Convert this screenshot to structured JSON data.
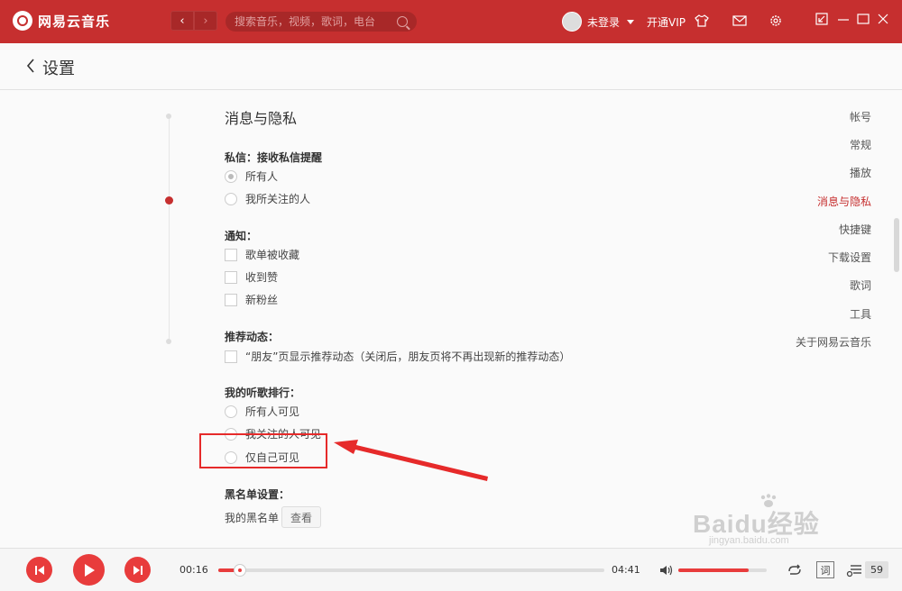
{
  "app": {
    "name": "网易云音乐",
    "brand_color": "#c62f2f"
  },
  "titlebar": {
    "nav_back_icon": "chevron-left",
    "nav_forward_icon": "chevron-right",
    "search_placeholder": "搜索音乐，视频，歌词，电台",
    "user_name": "未登录",
    "vip_label": "开通VIP"
  },
  "page": {
    "back_icon": "chevron-left",
    "title": "设置"
  },
  "sidebar": {
    "items": [
      {
        "label": "帐号"
      },
      {
        "label": "常规"
      },
      {
        "label": "播放"
      },
      {
        "label": "消息与隐私"
      },
      {
        "label": "快捷键"
      },
      {
        "label": "下载设置"
      },
      {
        "label": "歌词"
      },
      {
        "label": "工具"
      },
      {
        "label": "关于网易云音乐"
      }
    ],
    "active": "消息与隐私"
  },
  "content": {
    "section_title": "消息与隐私",
    "private_msg": {
      "title": "私信：接收私信提醒",
      "options": [
        "所有人",
        "我所关注的人"
      ],
      "selected": "所有人"
    },
    "notify": {
      "title": "通知：",
      "options": [
        "歌单被收藏",
        "收到赞",
        "新粉丝"
      ]
    },
    "recommend": {
      "title": "推荐动态：",
      "option": "“朋友”页显示推荐动态（关闭后，朋友页将不再出现新的推荐动态）"
    },
    "ranking": {
      "title": "我的听歌排行：",
      "options": [
        "所有人可见",
        "我关注的人可见",
        "仅自己可见"
      ]
    },
    "blacklist": {
      "title": "黑名单设置：",
      "label": "我的黑名单",
      "button": "查看"
    }
  },
  "watermark": {
    "main": "Baidu经验",
    "sub": "jingyan.baidu.com"
  },
  "player": {
    "current_time": "00:16",
    "total_time": "04:41",
    "progress_fraction": 0.057,
    "volume_fraction": 0.8,
    "lyric_label": "词",
    "playlist_count": "59"
  }
}
